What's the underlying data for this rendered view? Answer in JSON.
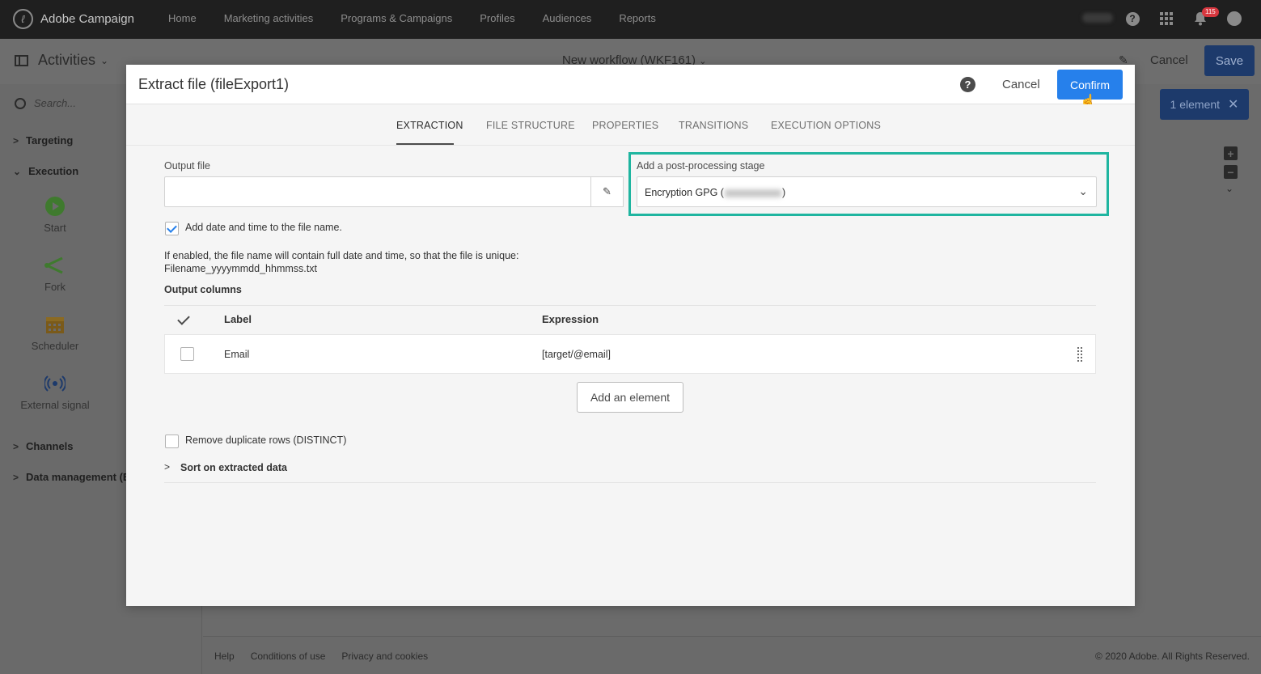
{
  "topbar": {
    "brand": "Adobe Campaign",
    "nav": [
      "Home",
      "Marketing activities",
      "Programs & Campaigns",
      "Profiles",
      "Audiences",
      "Reports"
    ],
    "notification_count": "115"
  },
  "background": {
    "activities_title": "Activities",
    "workflow_title": "New workflow (WKF161)",
    "cancel_label": "Cancel",
    "save_label": "Save",
    "search_placeholder": "Search...",
    "categories": [
      "Targeting",
      "Execution",
      "Channels",
      "Data management (ET"
    ],
    "activities": [
      "Start",
      "Fork",
      "Scheduler",
      "External signal"
    ],
    "selection_label": "1 element",
    "footer_links": [
      "Help",
      "Conditions of use",
      "Privacy and cookies"
    ],
    "copyright": "© 2020 Adobe. All Rights Reserved."
  },
  "modal": {
    "title": "Extract file (fileExport1)",
    "cancel_label": "Cancel",
    "confirm_label": "Confirm",
    "tabs": [
      "EXTRACTION",
      "FILE STRUCTURE",
      "PROPERTIES",
      "TRANSITIONS",
      "EXECUTION OPTIONS"
    ],
    "active_tab": "EXTRACTION",
    "output_file_label": "Output file",
    "output_file_value": "",
    "post_processing_label": "Add a post-processing stage",
    "post_processing_prefix": "Encryption GPG (",
    "post_processing_suffix": ")",
    "add_date_label": "Add date and time to the file name.",
    "add_date_checked": true,
    "info_line1": "If enabled, the file name will contain full date and time, so that the file is unique:",
    "info_line2": "Filename_yyyymmdd_hhmmss.txt",
    "output_columns_title": "Output columns",
    "columns_header": {
      "label": "Label",
      "expression": "Expression"
    },
    "rows": [
      {
        "label": "Email",
        "expression": "[target/@email]"
      }
    ],
    "add_element_label": "Add an element",
    "remove_duplicates_label": "Remove duplicate rows (DISTINCT)",
    "remove_duplicates_checked": false,
    "sort_label": "Sort on extracted data"
  },
  "colors": {
    "accent": "#2680eb",
    "highlight": "#1fb5a0",
    "topbar": "#1f1f1f"
  }
}
